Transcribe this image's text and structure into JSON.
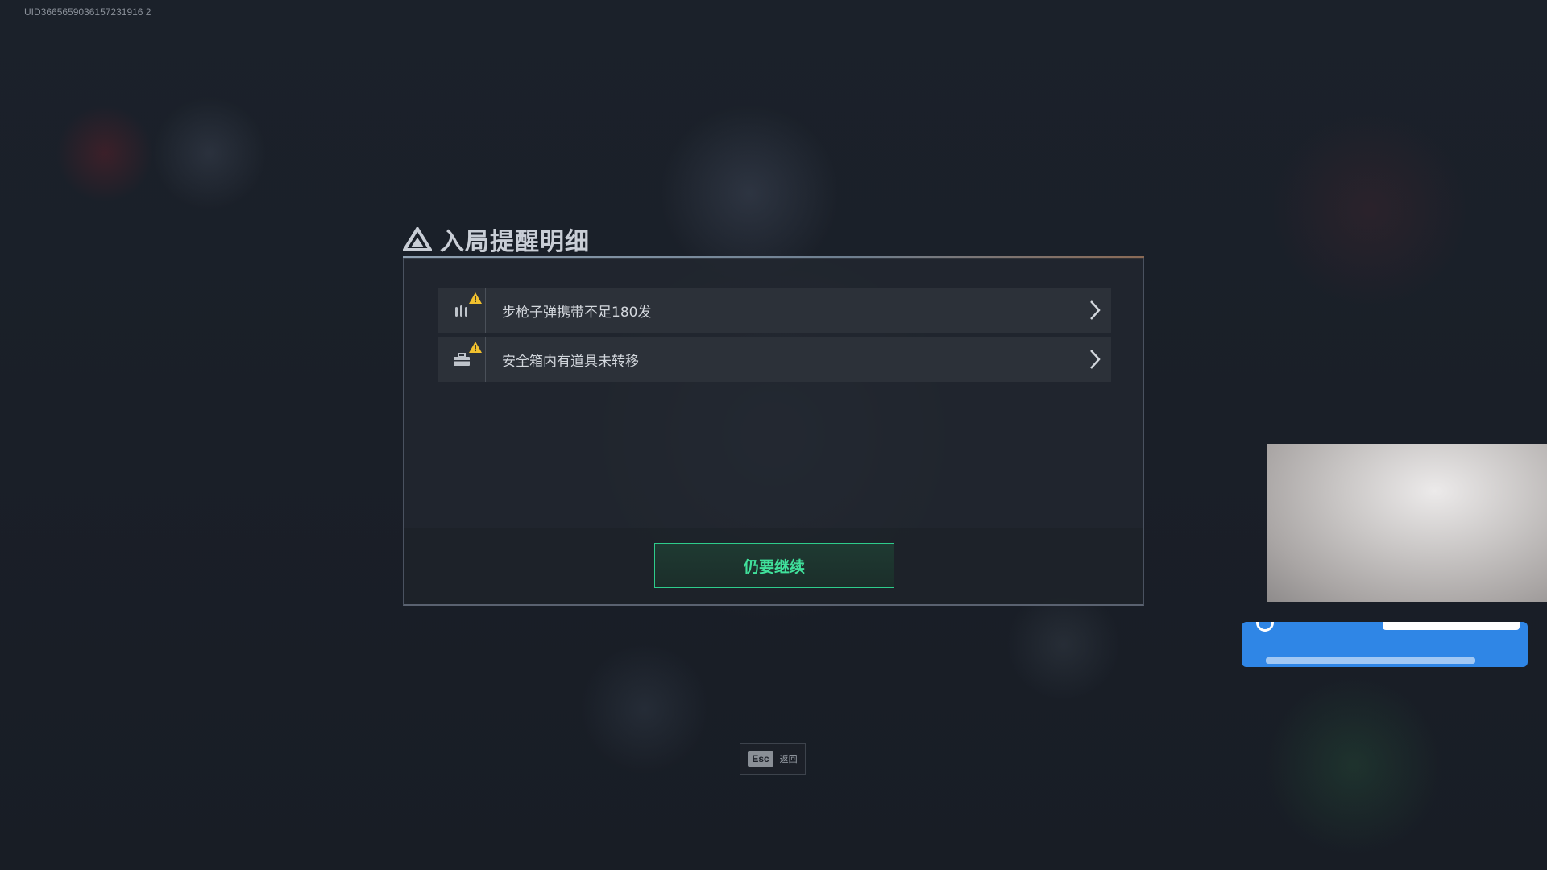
{
  "uid": "UID3665659036157231916 2",
  "title": "入局提醒明细",
  "reminders": [
    {
      "label": "步枪子弹携带不足180发",
      "icon": "ammo-icon"
    },
    {
      "label": "安全箱内有道具未转移",
      "icon": "safebox-icon"
    }
  ],
  "continue_label": "仍要继续",
  "esc": {
    "key": "Esc",
    "label": "返回"
  },
  "colors": {
    "accent_green": "#40e09b",
    "warning": "#f2c12e",
    "promo_blue": "#2f86e6"
  }
}
